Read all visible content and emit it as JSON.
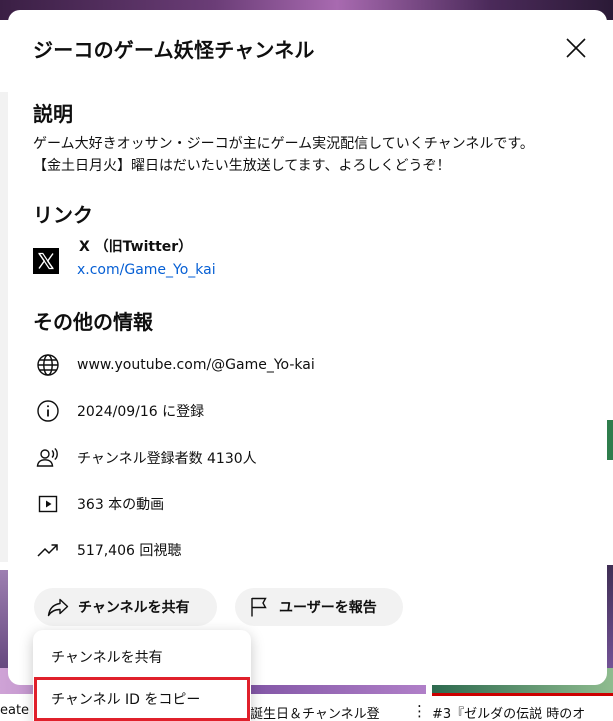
{
  "background": {
    "video_titles": [
      "eate",
      "誕生日＆チャンネル登",
      "#3『ゼルダの伝説 時のオ"
    ],
    "more_icon": "more-vert-icon"
  },
  "dialog": {
    "title": "ジーコのゲーム妖怪チャンネル",
    "close_icon": "close-icon",
    "description": {
      "heading": "説明",
      "lines": [
        "ゲーム大好きオッサン・ジーコが主にゲーム実況配信していくチャンネルです。",
        "【金土日月火】曜日はだいたい生放送してます、よろしくどうぞ！"
      ]
    },
    "links": {
      "heading": "リンク",
      "items": [
        {
          "icon": "x-logo-icon",
          "name": "X （旧Twitter）",
          "url": "x.com/Game_Yo_kai"
        }
      ]
    },
    "other_info": {
      "heading": "その他の情報",
      "items": [
        {
          "icon": "globe-icon",
          "text": "www.youtube.com/@Game_Yo-kai"
        },
        {
          "icon": "info-icon",
          "text": "2024/09/16 に登録"
        },
        {
          "icon": "subscribers-icon",
          "text": "チャンネル登録者数 4130人"
        },
        {
          "icon": "video-play-icon",
          "text": "363 本の動画"
        },
        {
          "icon": "trending-icon",
          "text": "517,406 回視聴"
        }
      ]
    },
    "actions": {
      "share_label": "チャンネルを共有",
      "report_label": "ユーザーを報告"
    }
  },
  "share_menu": {
    "items": [
      "チャンネルを共有",
      "チャンネル ID をコピー"
    ],
    "highlight_color": "#e0202b"
  },
  "colors": {
    "link": "#065fd4",
    "pill_bg": "#f2f2f2",
    "text": "#0f0f0f"
  }
}
